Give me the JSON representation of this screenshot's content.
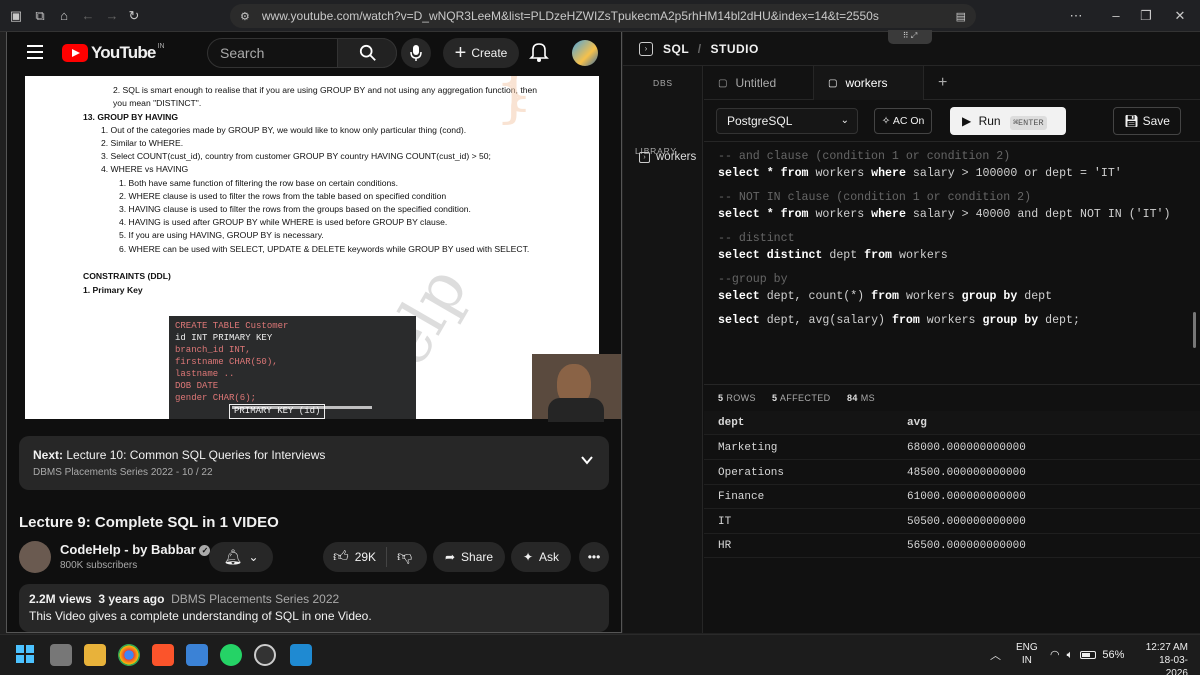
{
  "browser": {
    "url": "www.youtube.com/watch?v=D_wNQR3LeeM&list=PLDzeHZWIZsTpukecmA2p5rhHM14bl2dHU&index=14&t=2550s"
  },
  "youtube": {
    "logo_text": "YouTube",
    "logo_region": "IN",
    "search_placeholder": "Search",
    "create_label": "Create",
    "doc_lines": [
      "2.     SQL is smart enough to realise that if you are using GROUP BY and not using any aggregation function, then",
      "         you mean \"DISTINCT\".",
      "13.   GROUP BY HAVING",
      "1.     Out of the categories made by GROUP BY, we would like to know only particular thing (cond).",
      "2.     Similar to WHERE.",
      "3.     Select COUNT(cust_id), country from customer GROUP BY country HAVING COUNT(cust_id) > 50;",
      "4.     WHERE vs HAVING",
      "1.     Both have same function of filtering the row base on certain conditions.",
      "2.     WHERE clause is used to filter the rows from the table based on specified condition",
      "3.     HAVING clause is used to filter the rows from the groups based on the specified condition.",
      "4.     HAVING is used after GROUP BY while WHERE is used before GROUP BY clause.",
      "5.     If you are using HAVING, GROUP BY is necessary.",
      "6.     WHERE can be used with SELECT, UPDATE & DELETE keywords while GROUP BY used with SELECT.",
      "CONSTRAINTS (DDL)",
      "1.     Primary Key"
    ],
    "board_lines": [
      "CREATE TABLE  Customer",
      "   id  INT  PRIMARY KEY",
      "   branch_id  INT,",
      "   firstname  CHAR(50),",
      "   lastname  ..",
      "   DOB       DATE",
      "   gender   CHAR(6);",
      "   PRIMARY KEY (id)"
    ],
    "next_prefix": "Next:",
    "next_title": "Lecture 10: Common SQL Queries for Interviews",
    "next_series": "DBMS Placements Series 2022 - 10 / 22",
    "video_title": "Lecture 9: Complete SQL in 1 VIDEO",
    "channel_name": "CodeHelp - by Babbar",
    "subscribers": "800K subscribers",
    "likes": "29K",
    "share_label": "Share",
    "ask_label": "Ask",
    "views": "2.2M views",
    "age": "3 years ago",
    "playlist": "DBMS Placements Series 2022",
    "description": "This Video gives a complete understanding of SQL in one Video."
  },
  "studio": {
    "title": "SQL",
    "subtitle": "STUDIO",
    "side_dbs": "DBS",
    "side_library": "LIBRARY",
    "side_item": "workers",
    "tabs": [
      "Untitled",
      "workers"
    ],
    "engine": "PostgreSQL",
    "ac_label": "AC On",
    "run_label": "Run",
    "run_shortcut": "⌘ENTER",
    "save_label": "Save",
    "code": [
      {
        "t": "-- and clause (condition 1 or condition 2)",
        "c": "cm"
      },
      {
        "t": "select * from workers where salary > 100000 or dept = 'IT'",
        "c": "sql"
      },
      {
        "t": "",
        "c": "blank"
      },
      {
        "t": "-- NOT IN clause (condition 1 or condition 2)",
        "c": "cm"
      },
      {
        "t": "select * from workers where salary > 40000 and dept NOT IN ('IT')",
        "c": "sql"
      },
      {
        "t": "",
        "c": "blank"
      },
      {
        "t": "-- distinct",
        "c": "cm"
      },
      {
        "t": "select distinct dept from workers",
        "c": "sql"
      },
      {
        "t": "",
        "c": "blank"
      },
      {
        "t": "--group by",
        "c": "cm"
      },
      {
        "t": "select dept, count(*) from workers group by dept",
        "c": "sql"
      },
      {
        "t": "",
        "c": "blank"
      },
      {
        "t": "select dept, avg(salary) from workers group by dept;",
        "c": "sql"
      }
    ],
    "stats": {
      "rows": "5",
      "rows_label": "ROWS",
      "affected": "5",
      "affected_label": "AFFECTED",
      "ms": "84",
      "ms_label": "MS"
    },
    "columns": [
      "dept",
      "avg"
    ],
    "rows": [
      [
        "Marketing",
        "68000.000000000000"
      ],
      [
        "Operations",
        "48500.000000000000"
      ],
      [
        "Finance",
        "61000.000000000000"
      ],
      [
        "IT",
        "50500.000000000000"
      ],
      [
        "HR",
        "56500.000000000000"
      ]
    ]
  },
  "taskbar": {
    "lang": "ENG",
    "region": "IN",
    "battery": "56%",
    "time": "12:27 AM",
    "date": "18-03-2026"
  },
  "colors": {
    "yt_red": "#ff0000",
    "bg": "#0f0f0f",
    "run_bg": "#f2f2f2"
  }
}
